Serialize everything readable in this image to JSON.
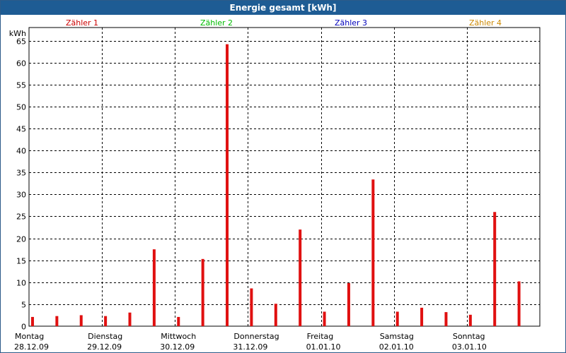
{
  "window": {
    "title": "Energie gesamt [kWh]"
  },
  "colors": {
    "bar": "#e01010",
    "title_bg": "#1e5c94",
    "grid": "#000000",
    "legend": [
      "#cc0000",
      "#00bb00",
      "#0000bb",
      "#cc8800"
    ]
  },
  "chart_data": {
    "type": "bar",
    "title": "Energie gesamt [kWh]",
    "ylabel": "kWh",
    "ylim": [
      0,
      68
    ],
    "yticks": [
      0,
      5,
      10,
      15,
      20,
      25,
      30,
      35,
      40,
      45,
      50,
      55,
      60,
      65
    ],
    "grid": true,
    "legend_position": "top",
    "legend": [
      "Zähler 1",
      "Zähler 2",
      "Zähler 3",
      "Zähler 4"
    ],
    "days": [
      {
        "label": "Montag",
        "date": "28.12.09"
      },
      {
        "label": "Dienstag",
        "date": "29.12.09"
      },
      {
        "label": "Mittwoch",
        "date": "30.12.09"
      },
      {
        "label": "Donnerstag",
        "date": "31.12.09"
      },
      {
        "label": "Freitag",
        "date": "01.01.10"
      },
      {
        "label": "Samstag",
        "date": "02.01.10"
      },
      {
        "label": "Sonntag",
        "date": "03.01.10"
      }
    ],
    "series": [
      {
        "values": [
          2.1,
          2.3,
          2.5,
          2.3,
          3.1,
          17.5,
          2.1,
          15.3,
          64.2,
          8.6,
          5.1,
          22.0,
          3.3,
          9.8,
          33.4,
          3.3,
          4.2,
          3.2,
          2.6,
          26.0,
          10.2
        ]
      }
    ]
  }
}
